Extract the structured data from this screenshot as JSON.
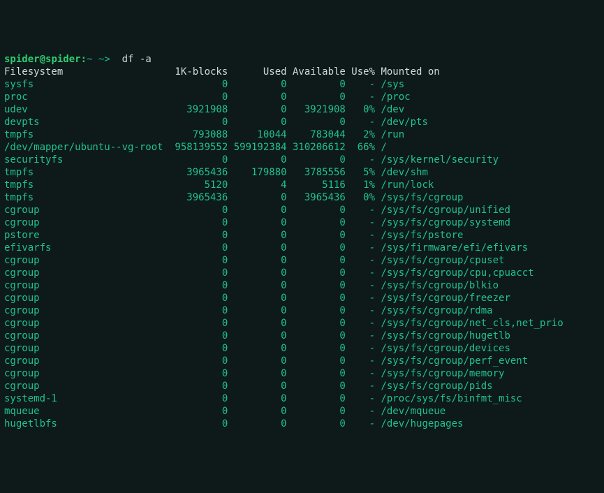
{
  "prompt": {
    "user": "spider",
    "host": "spider",
    "sep_userhost": "@",
    "sep_hostpath": ":",
    "path": "~",
    "arrow": "~>",
    "command": "df -a"
  },
  "header": {
    "filesystem": "Filesystem",
    "blocks": "1K-blocks",
    "used": "Used",
    "available": "Available",
    "usepct": "Use%",
    "mounted": "Mounted on"
  },
  "rows": [
    {
      "fs": "sysfs",
      "blocks": "0",
      "used": "0",
      "avail": "0",
      "usepct": "-",
      "mount": "/sys"
    },
    {
      "fs": "proc",
      "blocks": "0",
      "used": "0",
      "avail": "0",
      "usepct": "-",
      "mount": "/proc"
    },
    {
      "fs": "udev",
      "blocks": "3921908",
      "used": "0",
      "avail": "3921908",
      "usepct": "0%",
      "mount": "/dev"
    },
    {
      "fs": "devpts",
      "blocks": "0",
      "used": "0",
      "avail": "0",
      "usepct": "-",
      "mount": "/dev/pts"
    },
    {
      "fs": "tmpfs",
      "blocks": "793088",
      "used": "10044",
      "avail": "783044",
      "usepct": "2%",
      "mount": "/run"
    },
    {
      "fs": "/dev/mapper/ubuntu--vg-root",
      "blocks": "958139552",
      "used": "599192384",
      "avail": "310206612",
      "usepct": "66%",
      "mount": "/"
    },
    {
      "fs": "securityfs",
      "blocks": "0",
      "used": "0",
      "avail": "0",
      "usepct": "-",
      "mount": "/sys/kernel/security"
    },
    {
      "fs": "tmpfs",
      "blocks": "3965436",
      "used": "179880",
      "avail": "3785556",
      "usepct": "5%",
      "mount": "/dev/shm"
    },
    {
      "fs": "tmpfs",
      "blocks": "5120",
      "used": "4",
      "avail": "5116",
      "usepct": "1%",
      "mount": "/run/lock"
    },
    {
      "fs": "tmpfs",
      "blocks": "3965436",
      "used": "0",
      "avail": "3965436",
      "usepct": "0%",
      "mount": "/sys/fs/cgroup"
    },
    {
      "fs": "cgroup",
      "blocks": "0",
      "used": "0",
      "avail": "0",
      "usepct": "-",
      "mount": "/sys/fs/cgroup/unified"
    },
    {
      "fs": "cgroup",
      "blocks": "0",
      "used": "0",
      "avail": "0",
      "usepct": "-",
      "mount": "/sys/fs/cgroup/systemd"
    },
    {
      "fs": "pstore",
      "blocks": "0",
      "used": "0",
      "avail": "0",
      "usepct": "-",
      "mount": "/sys/fs/pstore"
    },
    {
      "fs": "efivarfs",
      "blocks": "0",
      "used": "0",
      "avail": "0",
      "usepct": "-",
      "mount": "/sys/firmware/efi/efivars"
    },
    {
      "fs": "cgroup",
      "blocks": "0",
      "used": "0",
      "avail": "0",
      "usepct": "-",
      "mount": "/sys/fs/cgroup/cpuset"
    },
    {
      "fs": "cgroup",
      "blocks": "0",
      "used": "0",
      "avail": "0",
      "usepct": "-",
      "mount": "/sys/fs/cgroup/cpu,cpuacct"
    },
    {
      "fs": "cgroup",
      "blocks": "0",
      "used": "0",
      "avail": "0",
      "usepct": "-",
      "mount": "/sys/fs/cgroup/blkio"
    },
    {
      "fs": "cgroup",
      "blocks": "0",
      "used": "0",
      "avail": "0",
      "usepct": "-",
      "mount": "/sys/fs/cgroup/freezer"
    },
    {
      "fs": "cgroup",
      "blocks": "0",
      "used": "0",
      "avail": "0",
      "usepct": "-",
      "mount": "/sys/fs/cgroup/rdma"
    },
    {
      "fs": "cgroup",
      "blocks": "0",
      "used": "0",
      "avail": "0",
      "usepct": "-",
      "mount": "/sys/fs/cgroup/net_cls,net_prio"
    },
    {
      "fs": "cgroup",
      "blocks": "0",
      "used": "0",
      "avail": "0",
      "usepct": "-",
      "mount": "/sys/fs/cgroup/hugetlb"
    },
    {
      "fs": "cgroup",
      "blocks": "0",
      "used": "0",
      "avail": "0",
      "usepct": "-",
      "mount": "/sys/fs/cgroup/devices"
    },
    {
      "fs": "cgroup",
      "blocks": "0",
      "used": "0",
      "avail": "0",
      "usepct": "-",
      "mount": "/sys/fs/cgroup/perf_event"
    },
    {
      "fs": "cgroup",
      "blocks": "0",
      "used": "0",
      "avail": "0",
      "usepct": "-",
      "mount": "/sys/fs/cgroup/memory"
    },
    {
      "fs": "cgroup",
      "blocks": "0",
      "used": "0",
      "avail": "0",
      "usepct": "-",
      "mount": "/sys/fs/cgroup/pids"
    },
    {
      "fs": "systemd-1",
      "blocks": "0",
      "used": "0",
      "avail": "0",
      "usepct": "-",
      "mount": "/proc/sys/fs/binfmt_misc"
    },
    {
      "fs": "mqueue",
      "blocks": "0",
      "used": "0",
      "avail": "0",
      "usepct": "-",
      "mount": "/dev/mqueue"
    },
    {
      "fs": "hugetlbfs",
      "blocks": "0",
      "used": "0",
      "avail": "0",
      "usepct": "-",
      "mount": "/dev/hugepages"
    }
  ],
  "cols": {
    "fs": 28,
    "blocks": 10,
    "used": 10,
    "avail": 10,
    "usepct": 5
  }
}
